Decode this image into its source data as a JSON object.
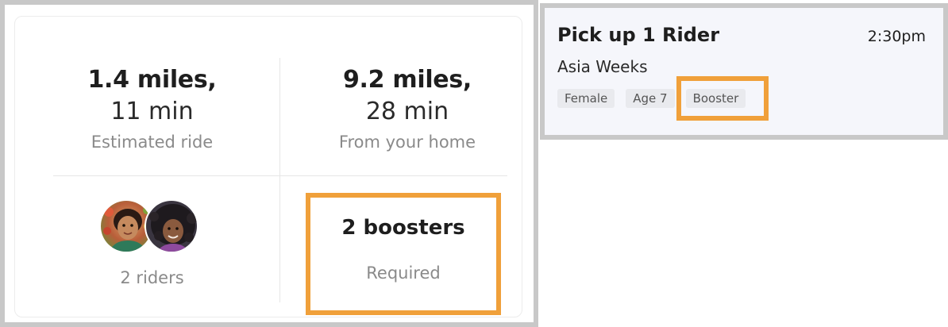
{
  "left_card": {
    "distance_ride": {
      "miles": "1.4 miles,",
      "time": "11 min",
      "caption": "Estimated ride"
    },
    "distance_home": {
      "miles": "9.2 miles,",
      "time": "28 min",
      "caption": "From your home"
    },
    "riders": {
      "label": "2 riders",
      "avatar_icons": [
        "rider-avatar-1",
        "rider-avatar-2"
      ]
    },
    "boosters": {
      "count_label": "2 boosters",
      "caption": "Required"
    }
  },
  "ride_card": {
    "title": "Pick up 1 Rider",
    "time": "2:30pm",
    "rider_name": "Asia Weeks",
    "tags": [
      "Female",
      "Age 7",
      "Booster"
    ]
  },
  "colors": {
    "highlight": "#f0a03a",
    "frame": "#c8c8c8",
    "card_background": "#f5f6fb",
    "tag_background": "#e9eaee",
    "muted_text": "#8a8a8a"
  }
}
